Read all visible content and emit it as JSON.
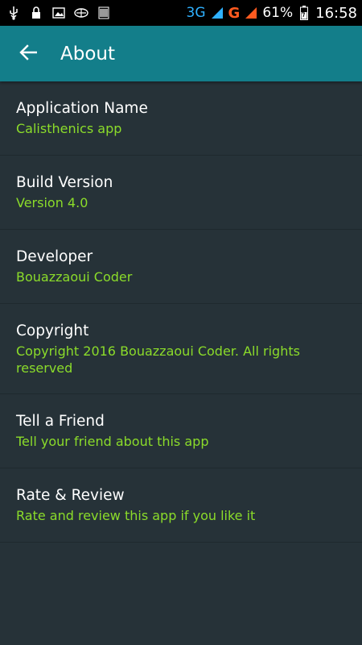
{
  "statusbar": {
    "network_3g": "3G",
    "network_g": "G",
    "battery": "61%",
    "time": "16:58",
    "icons": [
      "usb-icon",
      "lock-icon",
      "image-icon",
      "sync-icon",
      "barcode-icon",
      "signal-icon",
      "battery-icon"
    ]
  },
  "appbar": {
    "title": "About",
    "back_icon": "arrow-back-icon",
    "color": "#137e8a"
  },
  "items": [
    {
      "title": "Application Name",
      "subtitle": "Calisthenics app"
    },
    {
      "title": "Build Version",
      "subtitle": "Version 4.0"
    },
    {
      "title": "Developer",
      "subtitle": "Bouazzaoui Coder"
    },
    {
      "title": "Copyright",
      "subtitle": "Copyright 2016 Bouazzaoui Coder. All rights reserved"
    },
    {
      "title": "Tell a Friend",
      "subtitle": "Tell your friend about this app"
    },
    {
      "title": "Rate & Review",
      "subtitle": "Rate and review this app if you like it"
    }
  ],
  "colors": {
    "background": "#263238",
    "accent_text": "#8bdc2a",
    "title_text": "#ffffff"
  }
}
